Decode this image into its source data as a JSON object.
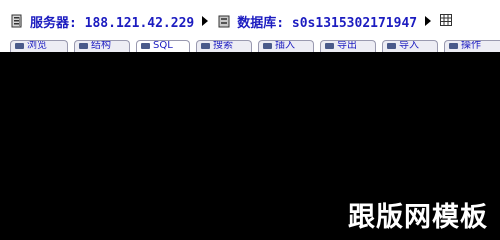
{
  "breadcrumb": {
    "server_label": "服务器: 188.121.42.229",
    "database_label": "数据库: s0s1315302171947"
  },
  "icons": {
    "server": "server-icon",
    "database": "database-icon",
    "table": "table-icon",
    "separator": "triangle-right-icon"
  },
  "tabs": [
    {
      "label": "浏览",
      "icon": "browse-icon"
    },
    {
      "label": "结构",
      "icon": "structure-icon"
    },
    {
      "label": "SQL",
      "icon": "sql-icon",
      "active": true
    },
    {
      "label": "搜索",
      "icon": "search-icon"
    },
    {
      "label": "插入",
      "icon": "insert-icon"
    },
    {
      "label": "导出",
      "icon": "export-icon"
    },
    {
      "label": "导入",
      "icon": "import-icon"
    },
    {
      "label": "操作",
      "icon": "operations-icon"
    }
  ],
  "watermark": "跟版网模板",
  "colors": {
    "link": "#1c1cc0",
    "background": "#000000",
    "bar": "#ffffff"
  }
}
